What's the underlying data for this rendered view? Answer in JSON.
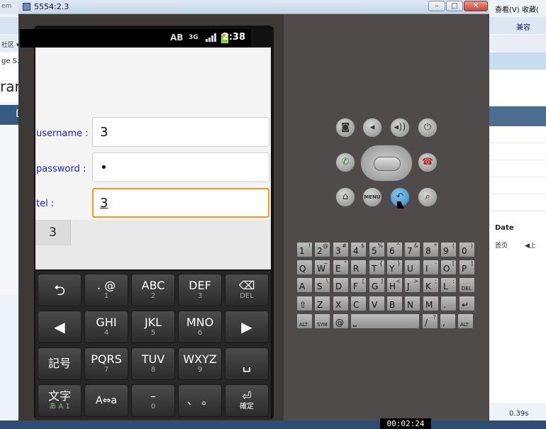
{
  "window": {
    "title": "5554:2.3",
    "minimize": "–",
    "maximize": "□",
    "close": "✕"
  },
  "background": {
    "left_snippets": [
      "em",
      "社区 ▾",
      "ge S...",
      "ran",
      "D"
    ],
    "right_menu": "查看(V)  收藏(",
    "right_toolbar": "兼容",
    "right_table_header": "Date",
    "right_cells": [
      "首页",
      "◀上"
    ],
    "right_status": "0.39s",
    "timer": "00:02:24"
  },
  "status_bar": {
    "time": "2:38",
    "icons": [
      "AB",
      "3G",
      "signal",
      "battery"
    ]
  },
  "form": {
    "username_label": "username :",
    "username_value": "3",
    "password_label": "password :",
    "password_value": "•",
    "tel_label": "tel :",
    "tel_value": "3",
    "suggestion": "3"
  },
  "keypad": {
    "rows": [
      [
        {
          "main": "⮌",
          "sub": "",
          "icon": "back-icon"
        },
        {
          "main": ". @",
          "sub": "1"
        },
        {
          "main": "ABC",
          "sub": "2"
        },
        {
          "main": "DEF",
          "sub": "3"
        },
        {
          "main": "⌫",
          "sub": "DEL",
          "icon": "delete-icon"
        }
      ],
      [
        {
          "main": "◀",
          "sub": "",
          "icon": "left-arrow-icon"
        },
        {
          "main": "GHI",
          "sub": "4"
        },
        {
          "main": "JKL",
          "sub": "5"
        },
        {
          "main": "MNO",
          "sub": "6"
        },
        {
          "main": "▶",
          "sub": "",
          "icon": "right-arrow-icon"
        }
      ],
      [
        {
          "main": "記号",
          "sub": ""
        },
        {
          "main": "PQRS",
          "sub": "7"
        },
        {
          "main": "TUV",
          "sub": "8"
        },
        {
          "main": "WXYZ",
          "sub": "9"
        },
        {
          "main": "␣",
          "sub": "",
          "icon": "space-icon"
        }
      ],
      [
        {
          "main": "文字",
          "sub": "あ A 1"
        },
        {
          "main": "A⇔a",
          "sub": ""
        },
        {
          "main": "–",
          "sub": "0"
        },
        {
          "main": "、 。",
          "sub": ""
        },
        {
          "main": "⏎",
          "sub": "確定"
        }
      ]
    ]
  },
  "hardware_buttons": [
    "camera",
    "volume-down",
    "volume-up",
    "power",
    "call",
    "end-call",
    "home",
    "MENU",
    "back",
    "search"
  ],
  "qwerty": {
    "rows": [
      [
        [
          "1",
          "!"
        ],
        [
          "2",
          "@"
        ],
        [
          "3",
          "#"
        ],
        [
          "4",
          "$"
        ],
        [
          "5",
          "%"
        ],
        [
          "6",
          "^"
        ],
        [
          "7",
          "&"
        ],
        [
          "8",
          "*"
        ],
        [
          "9",
          "("
        ],
        [
          "0",
          ")"
        ]
      ],
      [
        [
          "Q",
          ""
        ],
        [
          "W",
          "~"
        ],
        [
          "E",
          "\""
        ],
        [
          "R",
          ""
        ],
        [
          "T",
          "{"
        ],
        [
          "Y",
          "}"
        ],
        [
          "U",
          ""
        ],
        [
          "I",
          "-"
        ],
        [
          "O",
          "["
        ],
        [
          "P",
          "]"
        ]
      ],
      [
        [
          "A",
          ""
        ],
        [
          "S",
          "\\"
        ],
        [
          "D",
          ""
        ],
        [
          "F",
          "["
        ],
        [
          "G",
          "]"
        ],
        [
          "H",
          "<"
        ],
        [
          "J",
          ">"
        ],
        [
          "K",
          ";"
        ],
        [
          "L",
          ":"
        ],
        [
          "DEL",
          ""
        ]
      ],
      [
        [
          "⇧",
          ""
        ],
        [
          "Z",
          ""
        ],
        [
          "X",
          ""
        ],
        [
          "C",
          ""
        ],
        [
          "V",
          ""
        ],
        [
          "B",
          ""
        ],
        [
          "N",
          ""
        ],
        [
          "M",
          ""
        ],
        [
          ".",
          ""
        ],
        [
          "↵",
          ""
        ]
      ],
      [
        [
          "ALT",
          ""
        ],
        [
          "SYM",
          ""
        ],
        [
          "@",
          ""
        ],
        [
          "⎵",
          ""
        ],
        [
          "/",
          "?"
        ],
        [
          ",",
          ""
        ],
        [
          "ALT",
          ""
        ]
      ]
    ]
  }
}
